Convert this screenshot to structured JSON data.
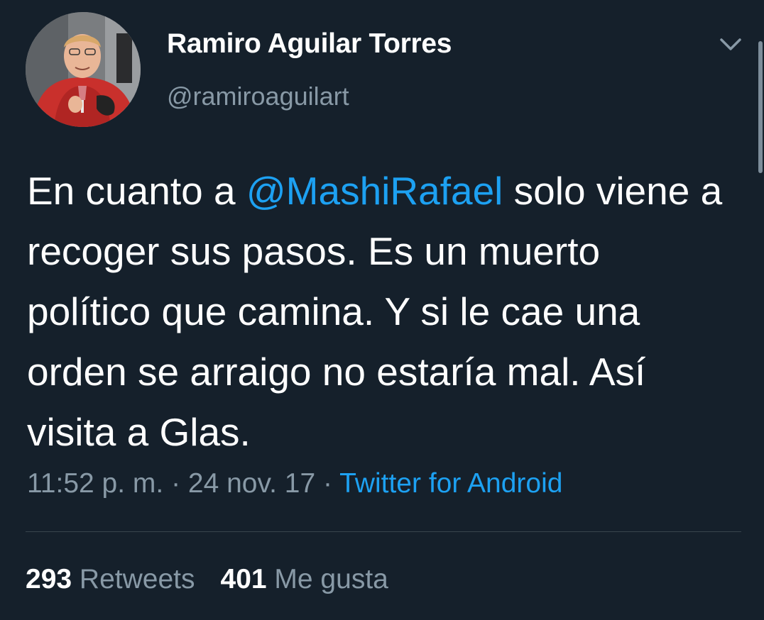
{
  "author": {
    "display_name": "Ramiro Aguilar Torres",
    "handle": "@ramiroaguilart"
  },
  "tweet": {
    "text_before_mention": "En cuanto a ",
    "mention": "@MashiRafael",
    "text_after_mention": " solo viene a recoger sus pasos. Es un muerto político que camina. Y si le cae una orden se arraigo no estaría mal. Así visita a Glas."
  },
  "meta": {
    "time": "11:52 p. m.",
    "separator": " · ",
    "date": "24 nov. 17",
    "source": "Twitter for Android"
  },
  "stats": {
    "retweets_count": "293",
    "retweets_label": "Retweets",
    "likes_count": "401",
    "likes_label": "Me gusta"
  },
  "colors": {
    "background": "#15202b",
    "accent": "#1da1f2",
    "secondary_text": "#8899a6",
    "divider": "#38444d"
  },
  "icons": {
    "menu": "chevron-down-icon"
  }
}
